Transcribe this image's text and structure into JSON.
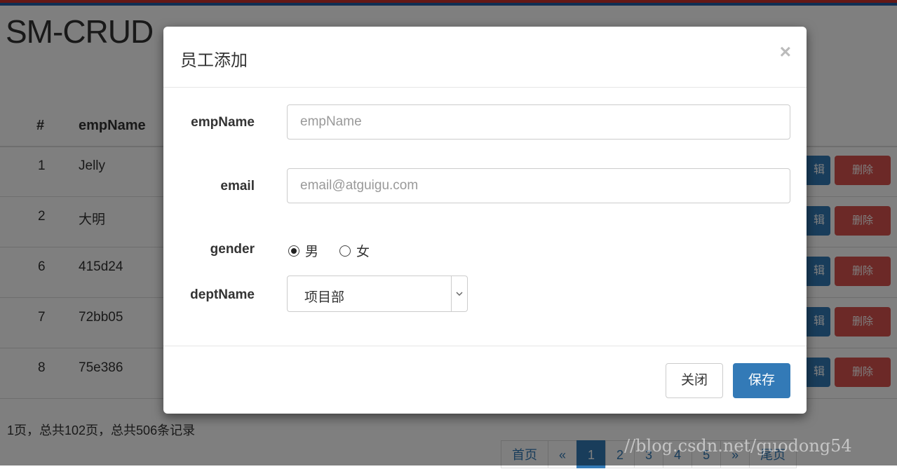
{
  "page": {
    "title": "SM-CRUD",
    "columns": [
      "#",
      "empName"
    ],
    "rows": [
      {
        "id": "1",
        "name": "Jelly"
      },
      {
        "id": "2",
        "name": "大明"
      },
      {
        "id": "6",
        "name": "415d24"
      },
      {
        "id": "7",
        "name": "72bb05"
      },
      {
        "id": "8",
        "name": "75e386"
      }
    ],
    "edit_label": "辑",
    "delete_label": "删除",
    "page_info": "1页，总共102页，总共506条记录",
    "pagination": {
      "first": "首页",
      "prev": "«",
      "pages": [
        "1",
        "2",
        "3",
        "4",
        "5"
      ],
      "active": "1",
      "next": "»",
      "last": "尾页"
    },
    "watermark": "//blog.csdn.net/guodong54"
  },
  "modal": {
    "title": "员工添加",
    "close_symbol": "×",
    "fields": {
      "empName": {
        "label": "empName",
        "placeholder": "empName",
        "value": ""
      },
      "email": {
        "label": "email",
        "placeholder": "email@atguigu.com",
        "value": ""
      },
      "gender": {
        "label": "gender",
        "options": [
          "男",
          "女"
        ],
        "selected": "男"
      },
      "deptName": {
        "label": "deptName",
        "selected": "项目部"
      }
    },
    "buttons": {
      "close": "关闭",
      "save": "保存"
    }
  },
  "colors": {
    "primary": "#337ab7",
    "danger": "#d9534f",
    "overlay": "rgba(0,0,0,0.5)"
  }
}
